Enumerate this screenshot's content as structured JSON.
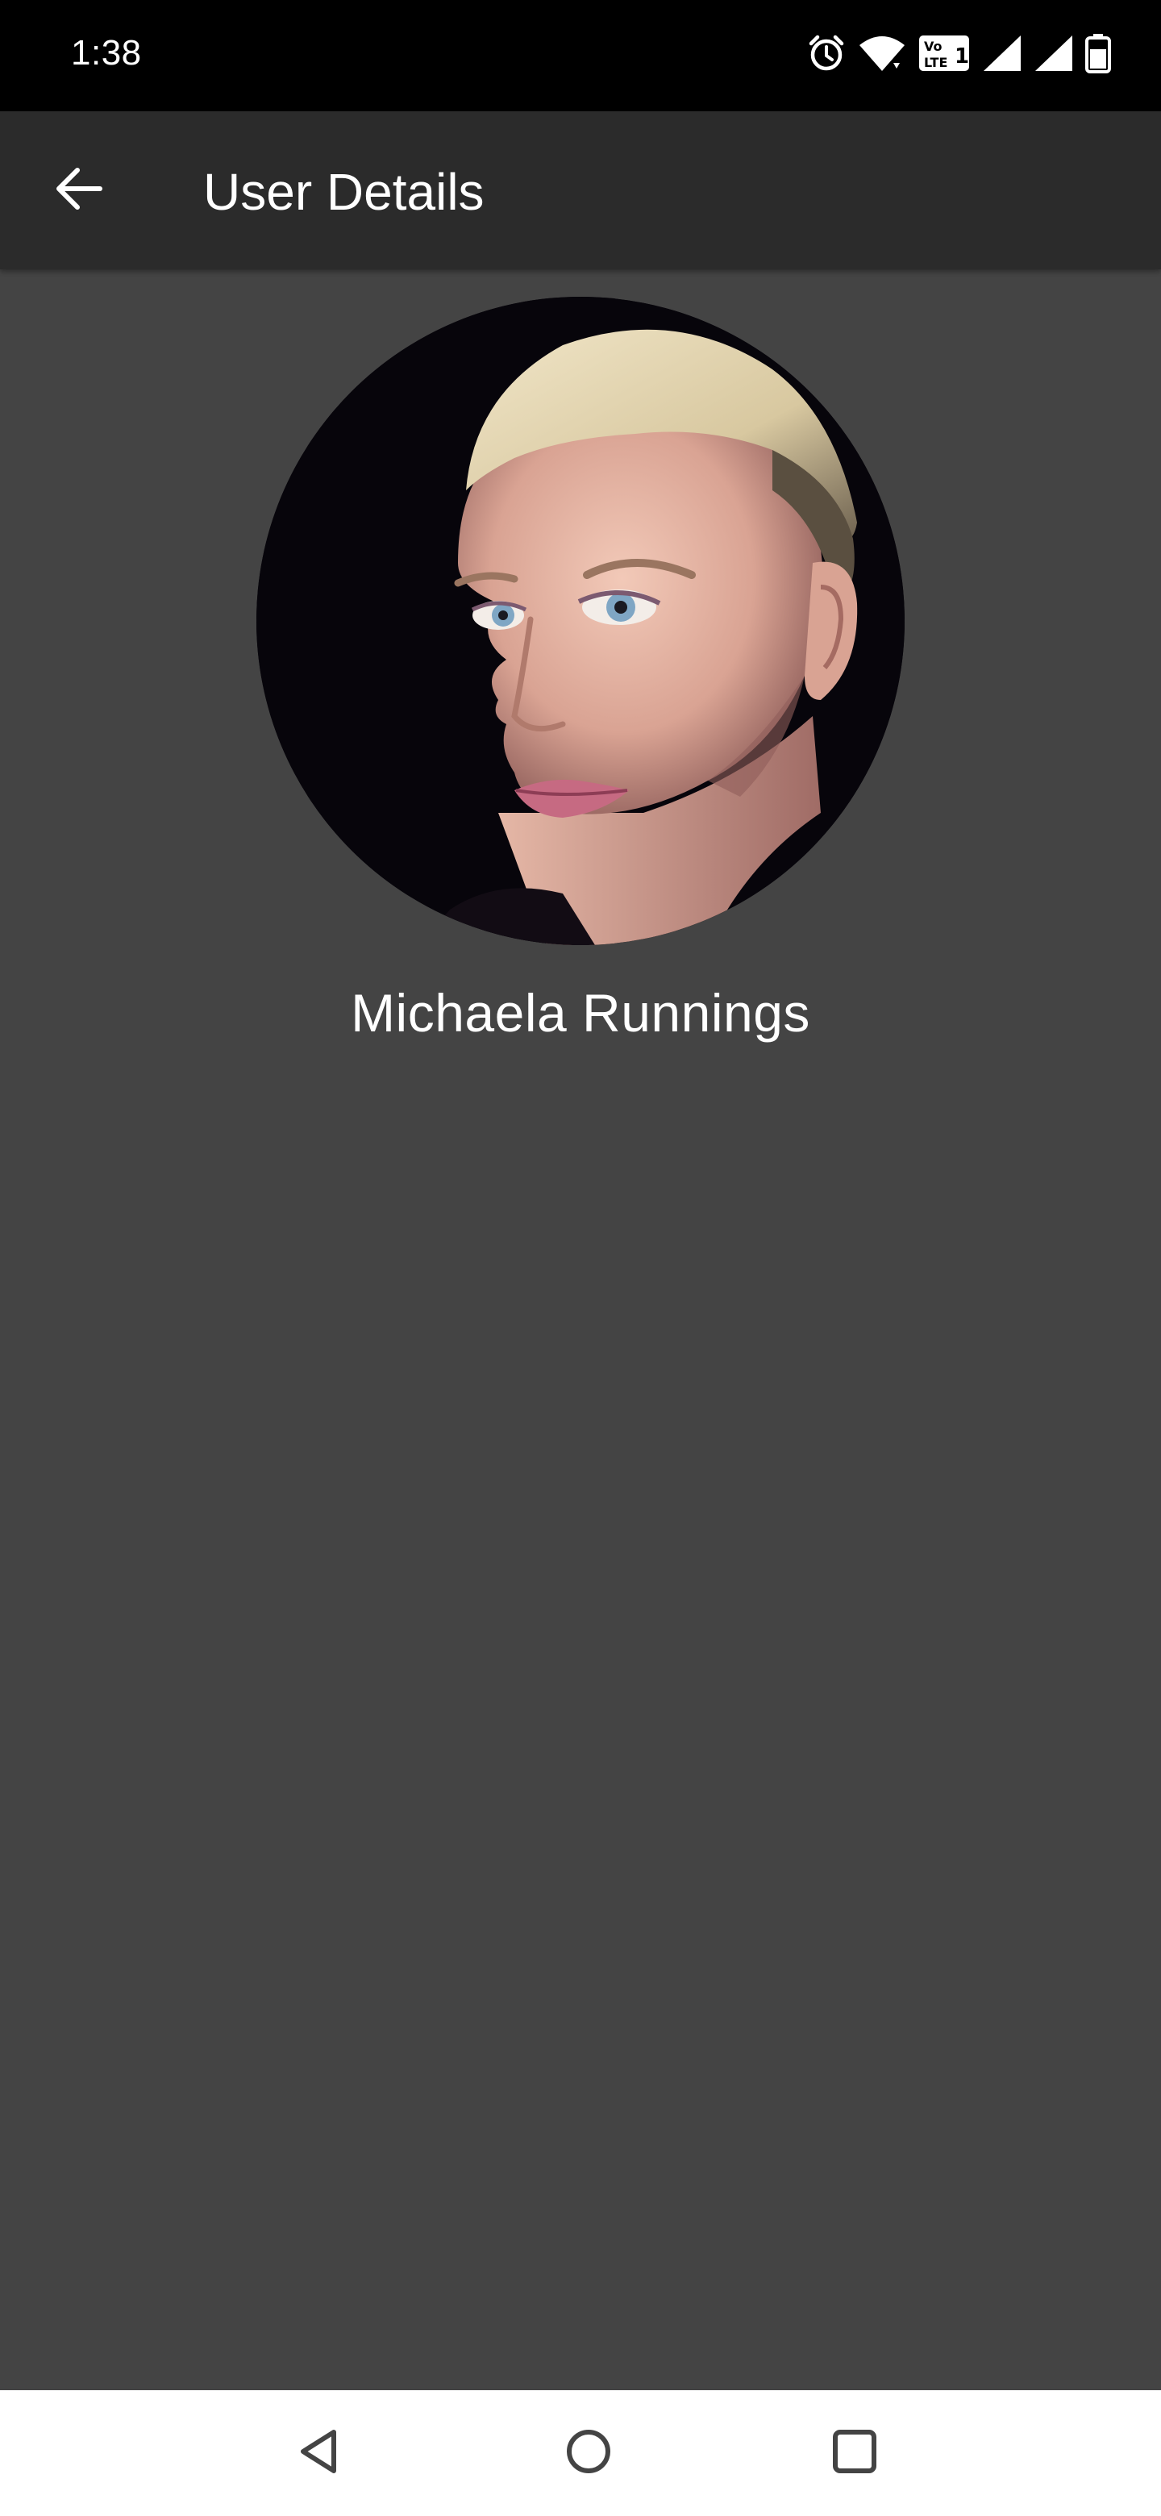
{
  "status_bar": {
    "time": "1:38",
    "icons": [
      "alarm-icon",
      "wifi-icon",
      "volte-icon",
      "signal-icon",
      "signal-icon",
      "battery-icon"
    ],
    "volte_label": "LTE"
  },
  "app_bar": {
    "title": "User Details",
    "back_icon": "arrow-back-icon"
  },
  "profile": {
    "name": "Michaela Runnings"
  },
  "nav_bar": {
    "icons": [
      "nav-back-icon",
      "nav-home-icon",
      "nav-recents-icon"
    ]
  },
  "colors": {
    "status_bar": "#000000",
    "app_bar": "#2b2b2b",
    "background": "#444444",
    "nav_bar": "#ffffff",
    "text": "#ffffff"
  }
}
